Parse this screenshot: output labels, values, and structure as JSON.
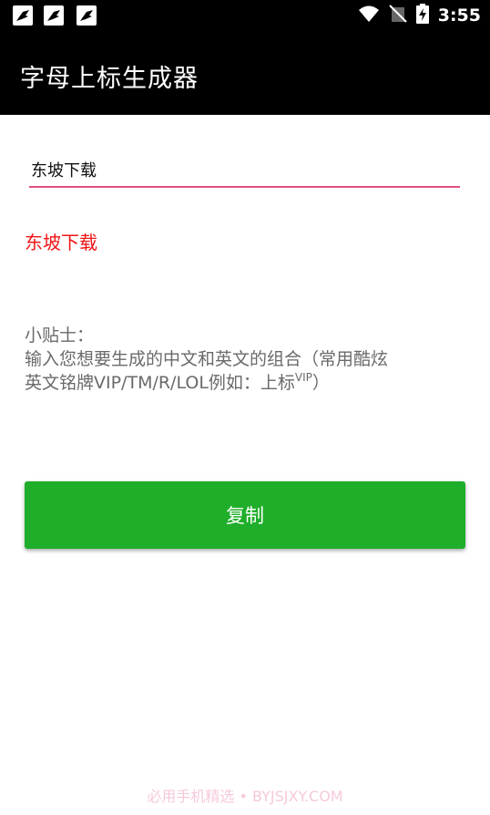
{
  "status_bar": {
    "time": "3:55",
    "notification_icons": [
      "bird-icon",
      "bird-icon",
      "bird-icon"
    ],
    "system_icons": [
      "wifi-icon",
      "no-sim-icon",
      "battery-charging-icon"
    ]
  },
  "app_bar": {
    "title": "字母上标生成器"
  },
  "input": {
    "value": "东坡下载"
  },
  "result": {
    "text": "东坡下载"
  },
  "tip": {
    "heading": "小贴士：",
    "line1": "输入您想要生成的中文和英文的组合（常用酷炫",
    "line2_prefix": "英文铭牌VIP/TM/R/LOL例如：上标",
    "line2_superscript": "VIP",
    "line2_suffix": "）"
  },
  "copy_button": {
    "label": "复制"
  },
  "watermark": {
    "text": "必用手机精选 • BYJSJXY.COM"
  },
  "colors": {
    "app_bar": "#000000",
    "input_underline": "#e0507f",
    "result_text": "#f01515",
    "button": "#1fae2a"
  }
}
